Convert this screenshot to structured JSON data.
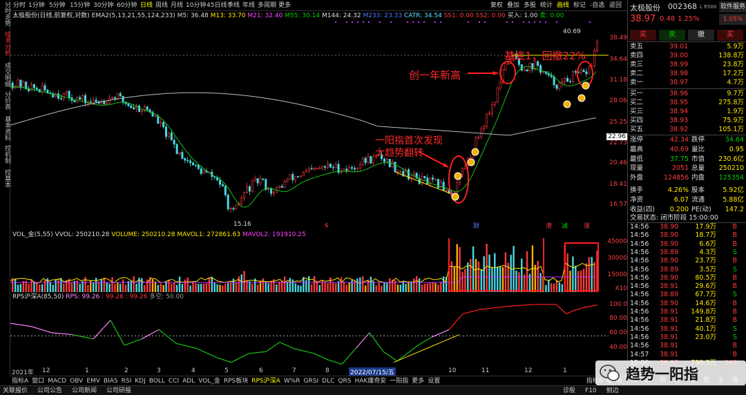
{
  "vtabs": [
    "分时走势",
    "技术分析",
    "成交明细",
    "分价表",
    "基本资料",
    "控机制",
    "控基本"
  ],
  "toolbar_left": [
    "分时",
    "1分钟",
    "5分钟",
    "15分钟",
    "30分钟",
    "60分钟",
    "日线",
    "周线",
    "月线",
    "10分钟",
    "45日线",
    "季线",
    "年线",
    "多周期",
    "更多"
  ],
  "toolbar_right": [
    "复权",
    "叠加",
    "多股",
    "统计",
    "画线",
    "标记",
    "-自选",
    "返回"
  ],
  "toolbar_selected": "日线",
  "main_info": {
    "name": "太极股份",
    "params": "(日线,前复权,对数)",
    "ema": "EMA2(5,13,21,55,124,233)",
    "m5": "M5: 36.48",
    "m13": "M13: 33.70",
    "m21": "M21: 32.40",
    "m55": "M55: 30.14",
    "m144": "M144: 24.32",
    "m233": "M233: 23.33",
    "catr": "CATR: 34.54",
    "ss1": "SS1: 0.00",
    "ss2": "SS2: 0.00",
    "buy": "买入: 1.00",
    "sell": "卖: 0.00"
  },
  "price_ticks": [
    "38.49",
    "34.64",
    "31.18",
    "28.06",
    "25.25",
    "22.73",
    "20.46",
    "18.41",
    "16.57"
  ],
  "current_price_label": "22.96",
  "hi_label": "40.69",
  "lo_label": "15.16",
  "annotations": {
    "new_high": "创一年新高",
    "base": "基底1，回撤22%",
    "first1": "一阳指首次发现",
    "first2": "大趋势翻转"
  },
  "event_labels": {
    "e1": "$",
    "e2": "财",
    "e3": "港",
    "e4": "减",
    "e5": "涨"
  },
  "vol_info": {
    "name": "VOL_金(5,55)",
    "vvol": "VVOL: 250210.28",
    "volume": "VOLUME: 250210.28",
    "mavol1": "MAVOL1: 272861.63",
    "mavol2": "MAVOL2: 191910.25"
  },
  "vol_ticks": [
    "45000",
    "30000",
    "15000",
    "X10"
  ],
  "rps_info": {
    "name": "RPS沪深A(85,50)",
    "rps": "RPS: 99.26",
    "v2": ": 99.26",
    "v3": ": 99.26",
    "v4": "多空: 50.00"
  },
  "rps_ticks": [
    "100.0",
    "80.00",
    "60.00",
    "40.00"
  ],
  "date_axis": {
    "year": "2021年",
    "labels": [
      "12",
      "1",
      "2",
      "3",
      "4",
      "5",
      "6",
      "7",
      "8",
      "9",
      "10",
      "11",
      "12",
      "1"
    ],
    "highlight": "2022/07/15/五"
  },
  "bottom_tabs": [
    "指标A",
    "窗口",
    "MACD",
    "OBV",
    "EMV",
    "BIAS",
    "RSI",
    "KDJ",
    "BOLL",
    "CCI",
    "ADL",
    "VOL_金",
    "RPS板块",
    "RPS沪深A",
    "W%R",
    "GRSI",
    "DLC",
    "QRS",
    "HAK庸奇安",
    "一阳指",
    "更多",
    "设置"
  ],
  "bottom_tabs_right": [
    "指标B",
    "模",
    "板"
  ],
  "status_bar": [
    "关联报价",
    "公司公告",
    "公司新闻",
    "公司研报"
  ],
  "status_right": [
    "诊股",
    "F10",
    "侧边"
  ],
  "quote": {
    "name": "太极股份",
    "code": "002368",
    "price": "38.97",
    "chg": "0.48",
    "pct": "1.25%",
    "tag": "软件服务",
    "tag_pct": "1.05%",
    "btns": [
      "买",
      "卖",
      "撤",
      "买"
    ],
    "asks": [
      [
        "卖五",
        "39.01",
        "5.9万"
      ],
      [
        "卖四",
        "39.00",
        "138.8万"
      ],
      [
        "卖三",
        "38.99",
        "23.8万"
      ],
      [
        "卖二",
        "38.98",
        "17.2万"
      ],
      [
        "卖一",
        "38.97",
        "4.7万"
      ]
    ],
    "bids": [
      [
        "买一",
        "38.96",
        "9.7万"
      ],
      [
        "买二",
        "38.95",
        "275.8万"
      ],
      [
        "买三",
        "38.94",
        "1.9万"
      ],
      [
        "买四",
        "38.93",
        "75.9万"
      ],
      [
        "买五",
        "38.92",
        "105.1万"
      ]
    ],
    "stats": [
      [
        "涨停",
        "42.34",
        "跌停",
        "34.64"
      ],
      [
        "最高",
        "40.69",
        "量比",
        "0.95"
      ],
      [
        "最低",
        "37.75",
        "市值",
        "230.6亿"
      ],
      [
        "现量",
        "2051",
        "总量",
        "250210"
      ],
      [
        "外盘",
        "124856",
        "内盘",
        "125354"
      ],
      [
        "换手",
        "4.26%",
        "股本",
        "5.92亿"
      ],
      [
        "净资",
        "6.07",
        "流通",
        "5.88亿"
      ],
      [
        "收益(四)",
        "0.200",
        "PE(动)",
        "147.2"
      ]
    ],
    "trade_status": "交易状态: 闭市阶段 15:00:00",
    "ticks": [
      [
        "14:56",
        "38.90",
        "17.9万",
        "B"
      ],
      [
        "14:56",
        "38.90",
        "18.7万",
        "B"
      ],
      [
        "14:56",
        "38.90",
        "6.6万",
        "B"
      ],
      [
        "14:56",
        "38.89",
        "4.3万",
        "S"
      ],
      [
        "14:56",
        "38.90",
        "23.7万",
        "B"
      ],
      [
        "14:56",
        "38.89",
        "3.5万",
        "S"
      ],
      [
        "14:56",
        "38.90",
        "80.5万",
        "B"
      ],
      [
        "14:56",
        "38.91",
        "29.6万",
        "B"
      ],
      [
        "14:56",
        "38.89",
        "67.7万",
        "S"
      ],
      [
        "14:56",
        "38.90",
        "14.6万",
        "B"
      ],
      [
        "14:56",
        "38.91",
        "149.8万",
        "B"
      ],
      [
        "14:56",
        "38.91",
        "21.8万",
        "B"
      ],
      [
        "14:56",
        "38.91",
        "40.1万",
        "S"
      ],
      [
        "14:56",
        "38.91",
        "23.0万",
        "S"
      ],
      [
        "14:56",
        "38.91",
        "",
        "B"
      ],
      [
        "14:57",
        "38.91",
        "",
        "B"
      ],
      [
        "15:00",
        "38.97",
        "799.3万",
        "340"
      ]
    ],
    "bottom_right_tabs": [
      "笔",
      "价",
      "细",
      "势",
      "联",
      "值",
      "主",
      "筹"
    ]
  },
  "watermark": "趋势一阳指"
}
